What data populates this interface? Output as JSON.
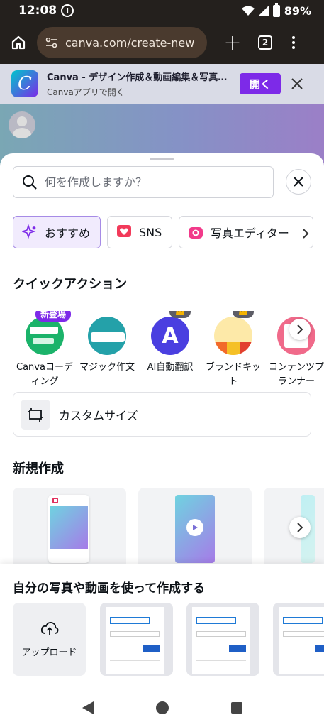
{
  "status_bar": {
    "time": "12:08",
    "battery": "89%"
  },
  "browser": {
    "url": "canva.com/create-new",
    "tab_count": "2"
  },
  "app_banner": {
    "title": "Canva - デザイン作成＆動画編集＆写真…",
    "subtitle": "Canvaアプリで開く",
    "open_label": "開く"
  },
  "search": {
    "placeholder": "何を作成しますか？"
  },
  "chips": [
    {
      "label": "おすすめ",
      "icon": "sparkle-icon"
    },
    {
      "label": "SNS",
      "icon": "heart-icon"
    },
    {
      "label": "写真エディター",
      "icon": "camera-icon"
    }
  ],
  "quick_actions": {
    "heading": "クイックアクション",
    "items": [
      {
        "label": "Canvaコーディング",
        "badge": "新登場"
      },
      {
        "label": "マジック作文"
      },
      {
        "label": "AI自動翻訳"
      },
      {
        "label": "ブランドキット"
      },
      {
        "label": "コンテンツプランナー"
      }
    ]
  },
  "custom_size": {
    "label": "カスタムサイズ"
  },
  "new_create": {
    "heading": "新規作成"
  },
  "own_media": {
    "heading": "自分の写真や動画を使って作成する",
    "upload_label": "アップロード"
  },
  "colors": {
    "accent": "#7d2ae8",
    "chip_active_bg": "#f1ebfd"
  }
}
